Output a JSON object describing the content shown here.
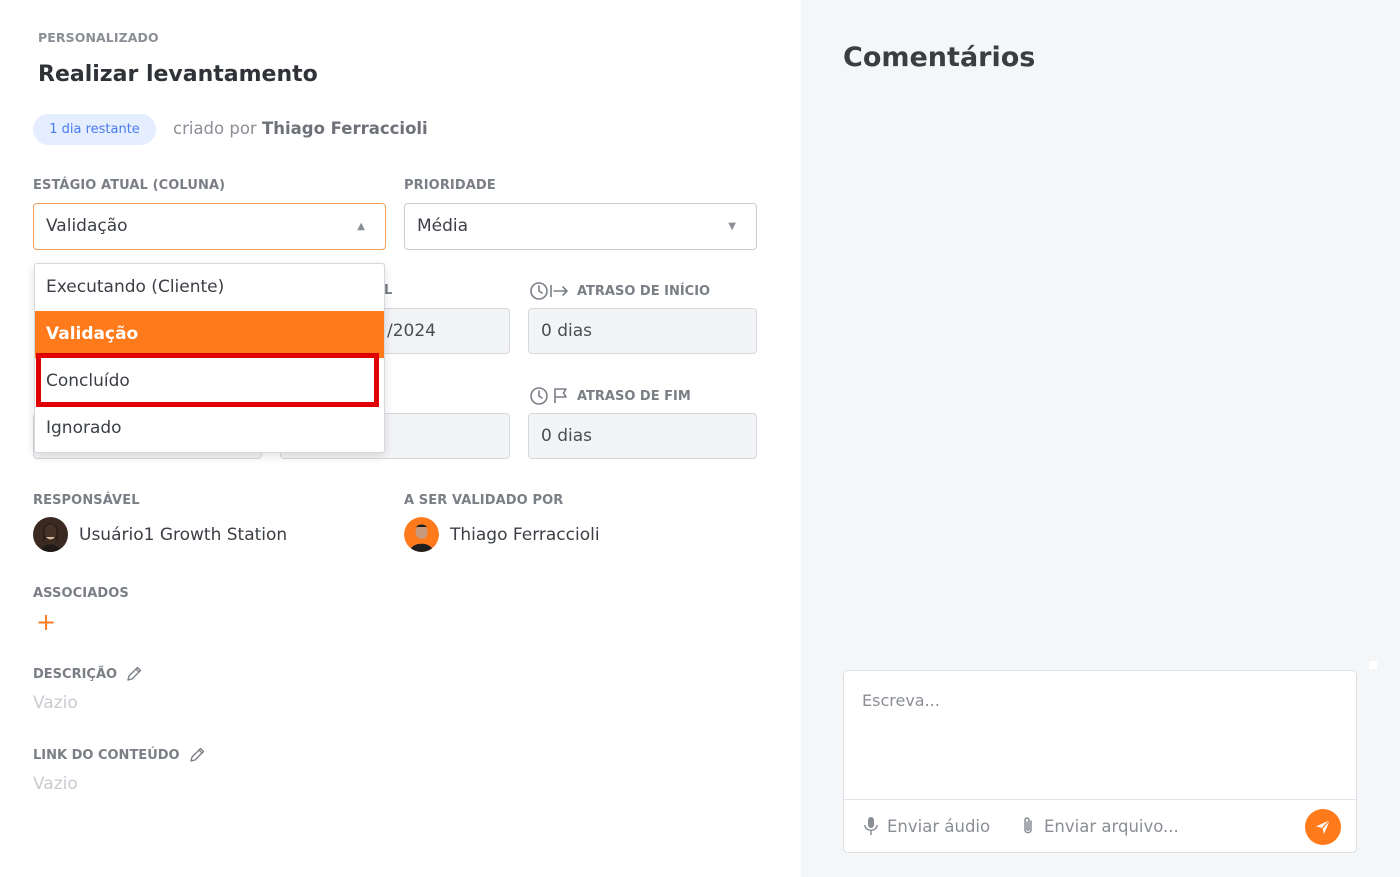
{
  "task": {
    "type": "PERSONALIZADO",
    "title": "Realizar levantamento",
    "badge": "1 dia restante",
    "created_by_prefix": "criado por",
    "created_by_name": "Thiago Ferraccioli"
  },
  "stage": {
    "label": "ESTÁGIO ATUAL (COLUNA)",
    "selected": "Validação",
    "options": [
      "Executando (Cliente)",
      "Validação",
      "Concluído",
      "Ignorado"
    ]
  },
  "priority": {
    "label": "PRIORIDADE",
    "selected": "Média"
  },
  "dates": {
    "start_label_fragment": "L",
    "start_value_fragment": "/2024",
    "start_delay_label": "ATRASO DE INÍCIO",
    "start_delay_value": "0 dias",
    "end_delay_label": "ATRASO DE FIM",
    "end_delay_value": "0 dias"
  },
  "responsible": {
    "label": "RESPONSÁVEL",
    "name": "Usuário1 Growth Station"
  },
  "validator": {
    "label": "A SER VALIDADO POR",
    "name": "Thiago Ferraccioli"
  },
  "associates": {
    "label": "ASSOCIADOS",
    "add_symbol": "+"
  },
  "description": {
    "label": "DESCRIÇÃO",
    "value": "Vazio"
  },
  "content_link": {
    "label": "LINK DO CONTEÚDO",
    "value": "Vazio"
  },
  "comments": {
    "title": "Comentários",
    "placeholder": "Escreva...",
    "send_audio": "Enviar áudio",
    "send_file": "Enviar arquivo..."
  },
  "colors": {
    "accent": "#ff7a1a",
    "badge_bg": "#e5eeff",
    "badge_text": "#4a7bf2",
    "highlight": "#e00000"
  }
}
